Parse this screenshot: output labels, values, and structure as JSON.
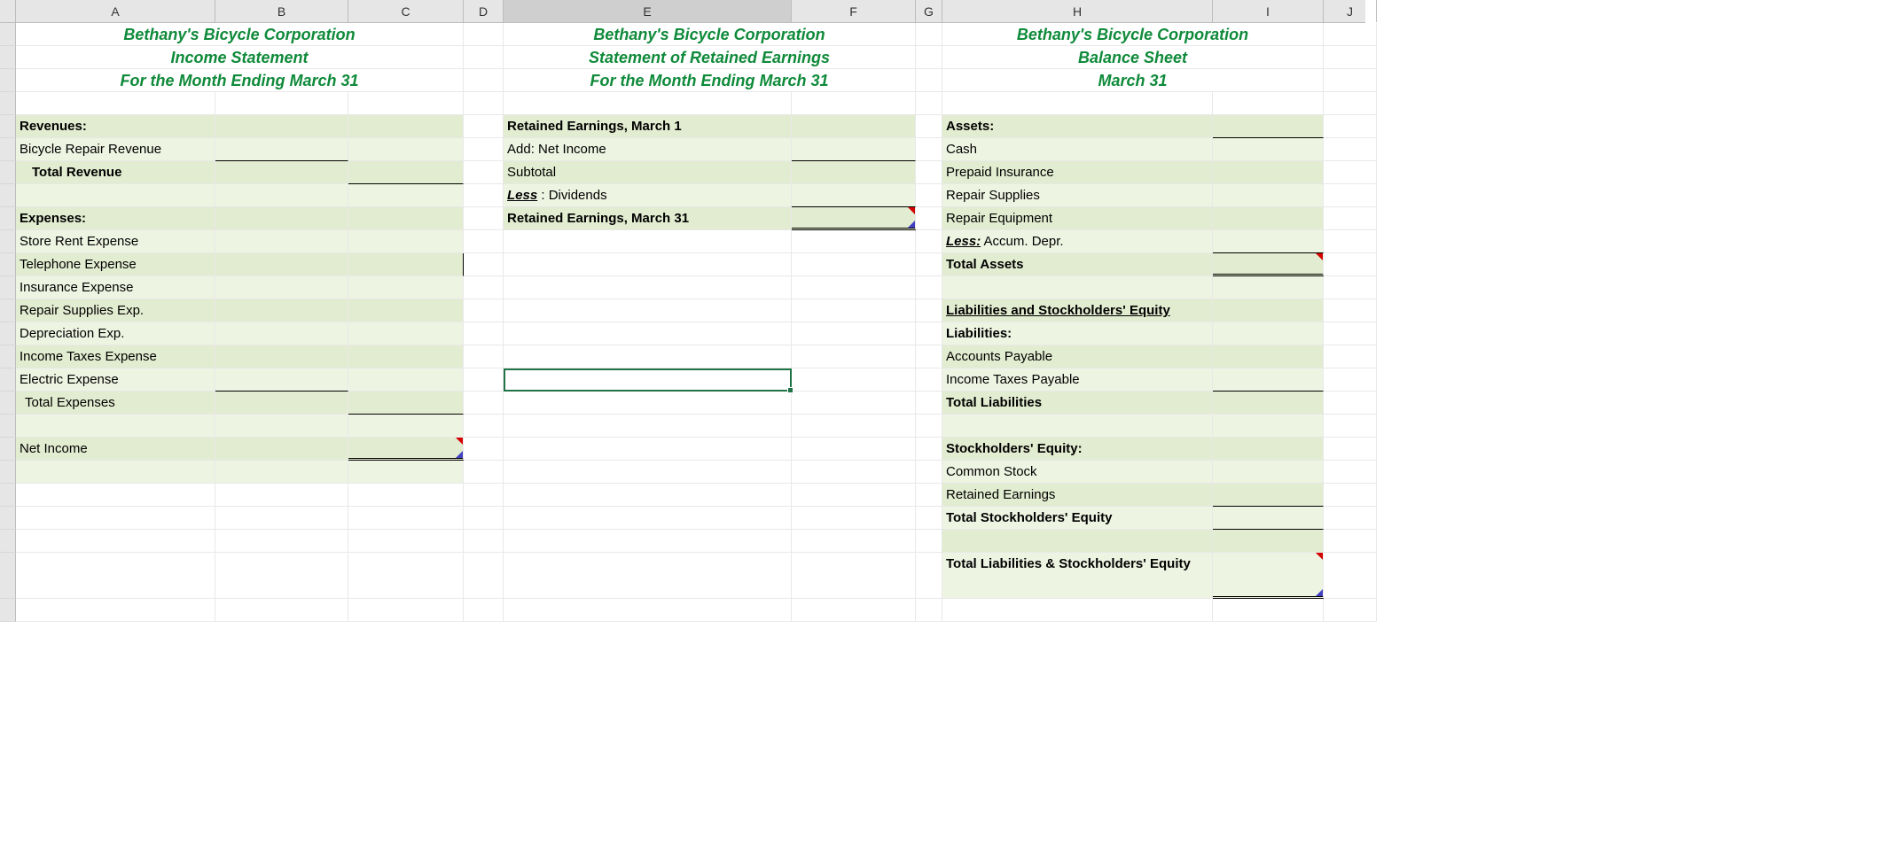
{
  "columns": [
    "A",
    "B",
    "C",
    "D",
    "E",
    "F",
    "G",
    "H",
    "I",
    "J"
  ],
  "selectedColumn": "E",
  "selectionCell": "E16",
  "title_company": "Bethany's Bicycle Corporation",
  "income": {
    "title2": "Income Statement",
    "title3": "For the Month Ending March 31",
    "revenues_header": "Revenues:",
    "bicycle_repair_revenue": "Bicycle Repair Revenue",
    "total_revenue": "Total Revenue",
    "expenses_header": "Expenses:",
    "store_rent": "Store Rent Expense",
    "telephone": "Telephone Expense",
    "insurance": "Insurance Expense",
    "repair_supplies": "Repair Supplies Exp.",
    "depreciation": "Depreciation Exp.",
    "income_taxes_exp": "Income Taxes Expense",
    "electric": "Electric Expense",
    "total_expenses": "Total Expenses",
    "net_income": "Net Income"
  },
  "retained": {
    "title2": "Statement of Retained Earnings",
    "title3": "For the Month Ending March 31",
    "march1": "Retained Earnings, March 1",
    "add_net_income": "Add: Net Income",
    "subtotal": "Subtotal",
    "less_label": "Less",
    "less_tail": " : Dividends",
    "march31": "Retained Earnings, March 31"
  },
  "balance": {
    "title2": "Balance Sheet",
    "title3": "March 31",
    "assets_header": "Assets:",
    "cash": "Cash",
    "prepaid_insurance": "Prepaid Insurance",
    "repair_supplies": "Repair Supplies",
    "repair_equipment": "Repair Equipment",
    "less_label": "Less:",
    "accum_depr": "  Accum. Depr.",
    "total_assets": "Total Assets",
    "liab_se_header": "Liabilities and Stockholders' Equity",
    "liabilities_header": "Liabilities:",
    "accounts_payable": "Accounts Payable",
    "income_taxes_payable": "Income Taxes Payable",
    "total_liabilities": "Total Liabilities",
    "se_header": "Stockholders' Equity:",
    "common_stock": "Common Stock",
    "retained_earnings": "Retained Earnings",
    "total_se": "Total Stockholders' Equity",
    "total_liab_se": "Total Liabilities & Stockholders' Equity"
  }
}
